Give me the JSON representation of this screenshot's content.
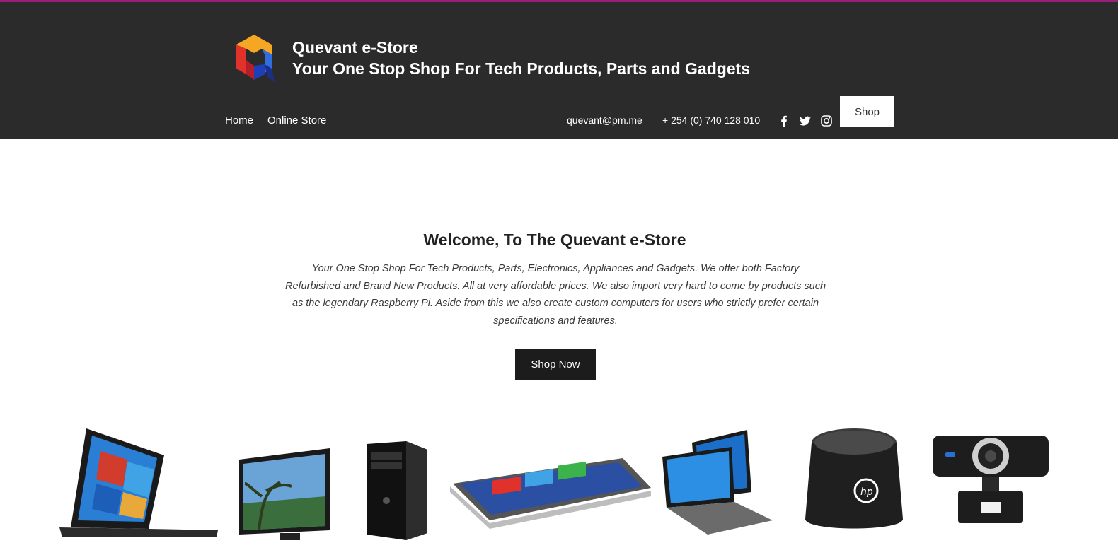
{
  "header": {
    "title": "Quevant e-Store",
    "subtitle": "Your One Stop Shop For Tech Products, Parts and Gadgets",
    "nav": [
      {
        "label": "Home"
      },
      {
        "label": "Online Store"
      }
    ],
    "email": "quevant@pm.me",
    "phone": "+ 254 (0) 740 128 010",
    "social_icons": [
      "facebook-icon",
      "twitter-icon",
      "instagram-icon"
    ],
    "shop_label": "Shop"
  },
  "hero": {
    "title": "Welcome, To The Quevant e-Store",
    "text": "Your One Stop Shop For Tech Products, Parts, Electronics, Appliances and Gadgets.  We offer both Factory Refurbished and Brand New Products. All at very affordable prices. We also import very hard to come by products such as the legendary Raspberry Pi. Aside from this we also create custom computers for users who strictly prefer certain specifications and features.",
    "button_label": "Shop Now"
  },
  "products": [
    {
      "icon": "laptop-icon"
    },
    {
      "icon": "monitor-icon"
    },
    {
      "icon": "desktop-tower-icon"
    },
    {
      "icon": "convertible-laptop-icon"
    },
    {
      "icon": "flip-laptop-icon"
    },
    {
      "icon": "speaker-icon"
    },
    {
      "icon": "webcam-icon"
    }
  ],
  "colors": {
    "top_accent": "#9a1f79",
    "header_bg": "#2b2b2b",
    "button_dark": "#1c1c1c"
  }
}
